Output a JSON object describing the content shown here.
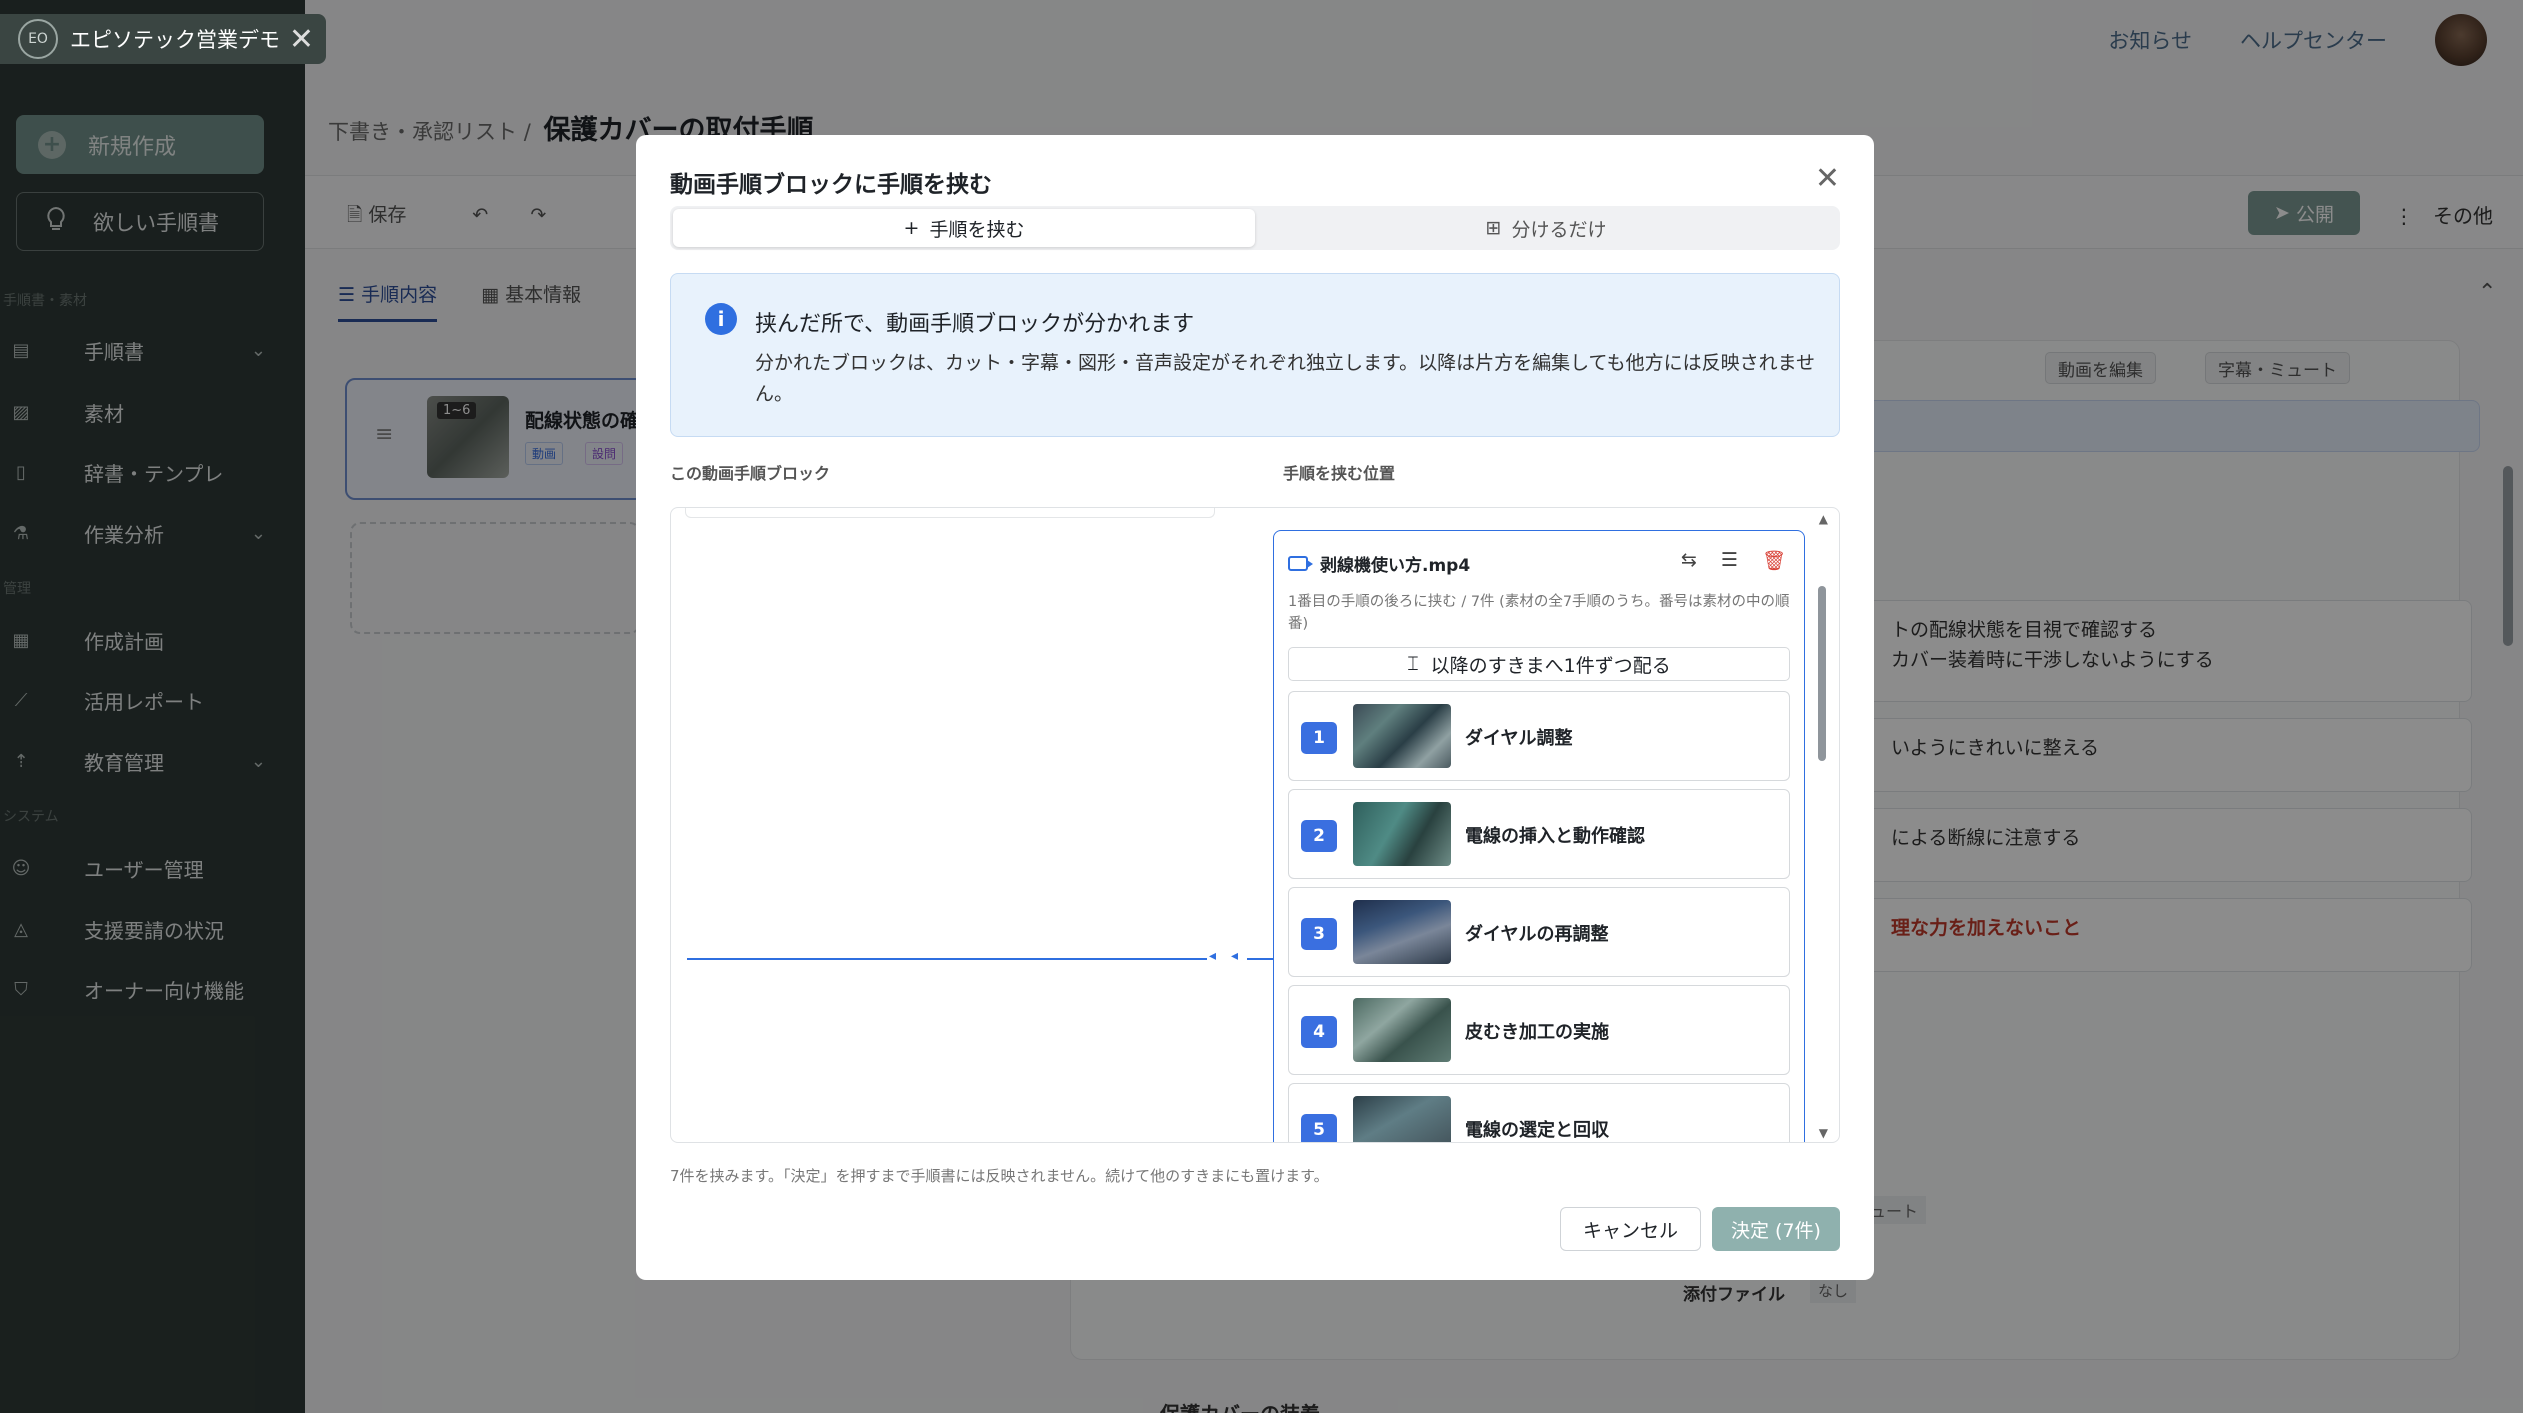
{
  "sidebar": {
    "brand": "エピソテック営業デモ",
    "logo_text": "EO",
    "new_button": "新規作成",
    "want_button": "欲しい手順書",
    "sections": [
      "手順書・素材",
      "管理",
      "システム"
    ],
    "items": [
      {
        "label": "手順書",
        "icon": "document-icon",
        "chevron": true
      },
      {
        "label": "素材",
        "icon": "image-icon",
        "chevron": false
      },
      {
        "label": "辞書・テンプレ",
        "icon": "book-icon",
        "chevron": false
      },
      {
        "label": "作業分析",
        "icon": "flask-icon",
        "chevron": true
      },
      {
        "label": "作成計画",
        "icon": "calendar-icon",
        "chevron": false
      },
      {
        "label": "活用レポート",
        "icon": "chart-icon",
        "chevron": false
      },
      {
        "label": "教育管理",
        "icon": "rocket-icon",
        "chevron": true
      },
      {
        "label": "ユーザー管理",
        "icon": "users-icon",
        "chevron": false
      },
      {
        "label": "支援要請の状況",
        "icon": "alarm-icon",
        "chevron": false
      },
      {
        "label": "オーナー向け機能",
        "icon": "shield-icon",
        "chevron": false
      }
    ]
  },
  "topbar": {
    "news": "お知らせ",
    "help": "ヘルプセンター"
  },
  "breadcrumb": {
    "parent": "下書き・承認リスト",
    "separator": "/",
    "title": "保護カバーの取付手順"
  },
  "toolbar": {
    "save": "保存",
    "publish": "公開",
    "more": "その他"
  },
  "page_tabs": [
    "手順内容",
    "基本情報"
  ],
  "background": {
    "card_badge": "1~6",
    "card_title": "配線状態の確",
    "card_tags": [
      "動画",
      "設問"
    ],
    "edit_video": "動画を編集",
    "subtitle_mute": "字幕・ミュート",
    "rows": [
      "トの配線状態を目視で確認する\nカバー装着時に干渉しないようにする",
      "いようにきれいに整える",
      "による断線に注意する",
      "理な力を加えないこと"
    ],
    "row_mute": "ュート",
    "attach_label": "添付ファイル",
    "attach_value": "なし",
    "next_section": "保護カバーの装着"
  },
  "modal": {
    "title": "動画手順ブロックに手順を挟む",
    "tabs": [
      {
        "label": "手順を挟む",
        "icon": "plus-icon",
        "active": true
      },
      {
        "label": "分けるだけ",
        "icon": "split-icon",
        "active": false
      }
    ],
    "info_title": "挟んだ所で、動画手順ブロックが分かれます",
    "info_body": "分かれたブロックは、カット・字幕・図形・音声設定がそれぞれ独立します。以降は片方を編集しても他方には反映されません。",
    "col_left": "この動画手順ブロック",
    "col_right": "手順を挟む位置",
    "video_file": "剥線機使い方.mp4",
    "video_desc": "1番目の手順の後ろに挟む / 7件 (素材の全7手順のうち。番号は素材の中の順番)",
    "distribute": "以降のすきまへ1件ずつ配る",
    "steps": [
      {
        "num": "1",
        "label": "ダイヤル調整"
      },
      {
        "num": "2",
        "label": "電線の挿入と動作確認"
      },
      {
        "num": "3",
        "label": "ダイヤルの再調整"
      },
      {
        "num": "4",
        "label": "皮むき加工の実施"
      },
      {
        "num": "5",
        "label": "電線の選定と回収"
      }
    ],
    "footer_note": "7件を挟みます。「決定」を押すまで手順書には反映されません。続けて他のすきまにも置けます。",
    "cancel": "キャンセル",
    "confirm": "決定 (7件)"
  }
}
